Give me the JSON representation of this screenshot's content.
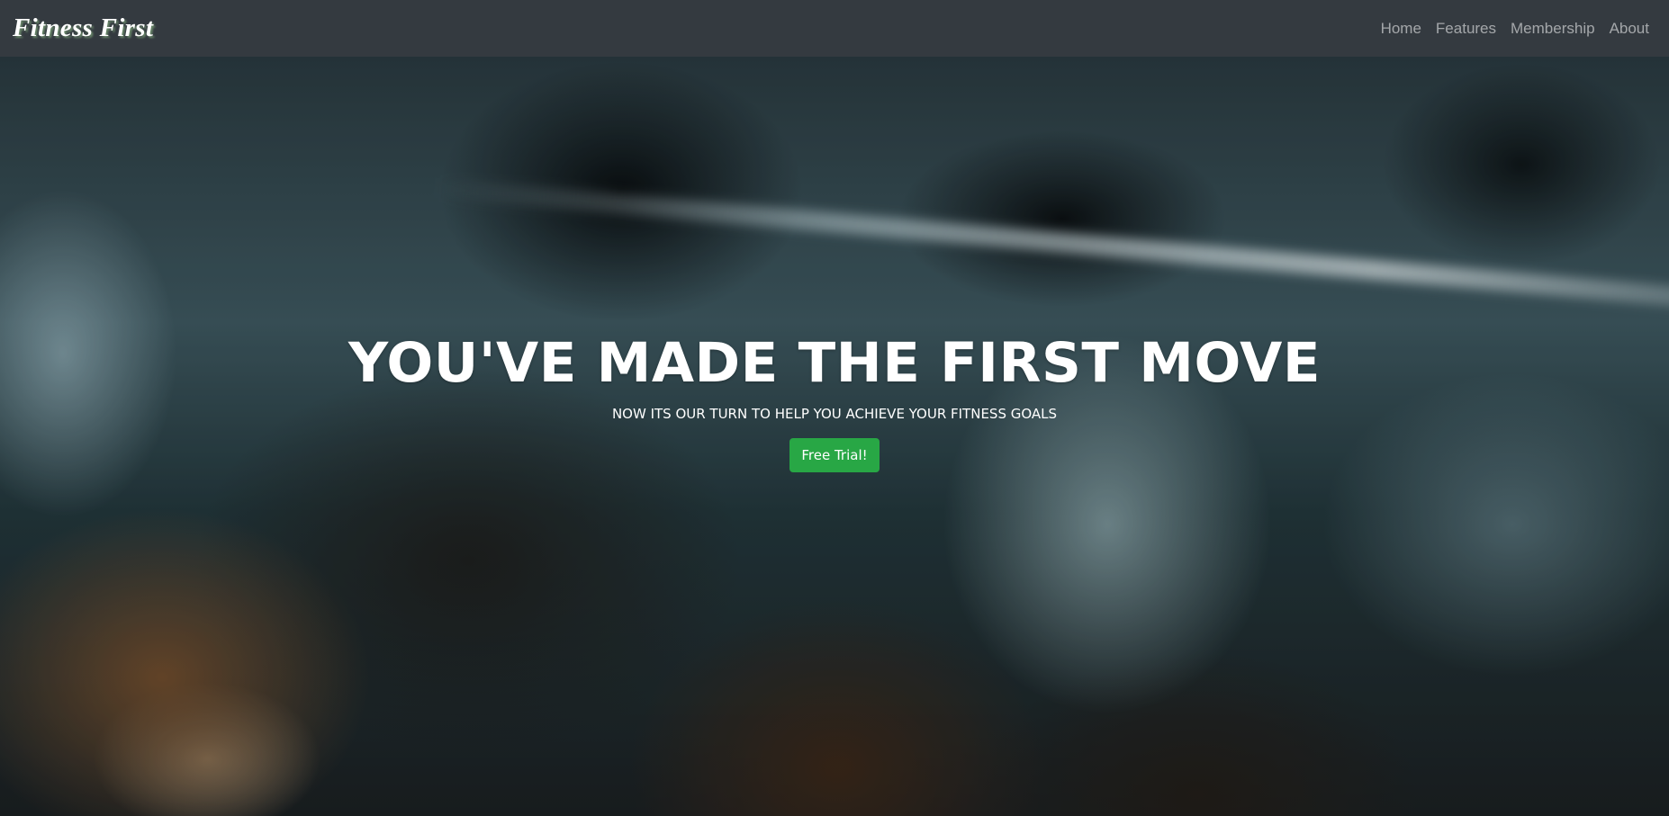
{
  "navbar": {
    "brand": "Fitness First",
    "links": [
      {
        "label": "Home"
      },
      {
        "label": "Features"
      },
      {
        "label": "Membership"
      },
      {
        "label": "About"
      }
    ],
    "background": "#343a40"
  },
  "hero": {
    "title": "YOU'VE MADE THE FIRST MOVE",
    "subtitle": "NOW ITS OUR TURN TO HELP YOU ACHIEVE YOUR FITNESS GOALS",
    "cta_label": "Free Trial!",
    "cta_color": "#28a745",
    "background_image": "blurred gym dumbbell rack"
  }
}
